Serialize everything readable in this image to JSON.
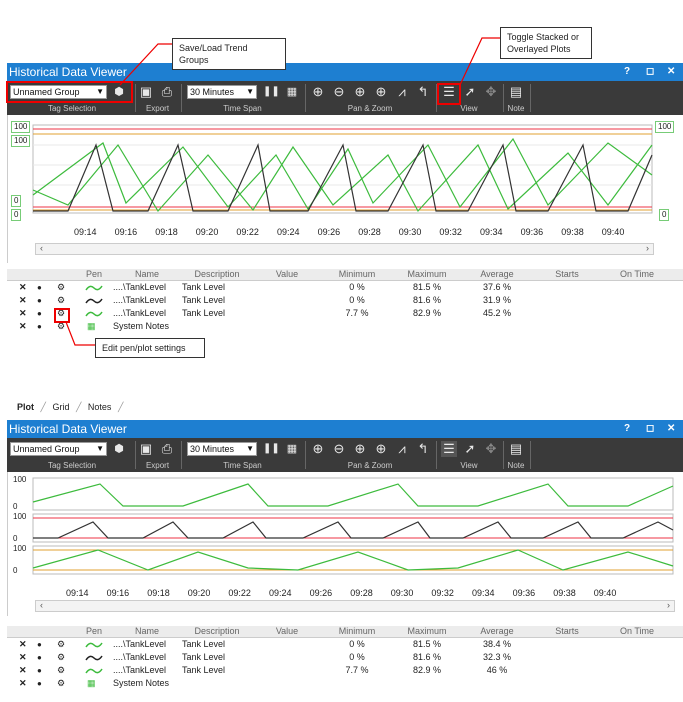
{
  "callouts": {
    "save_load": "Save/Load Trend Groups",
    "toggle": "Toggle Stacked or Overlayed Plots",
    "edit_pen": "Edit pen/plot settings"
  },
  "window_title": "Historical Data Viewer",
  "title_controls": {
    "help": "?",
    "max": "◻",
    "close": "✕"
  },
  "toolbar": {
    "group_select": "Unnamed Group",
    "tag_selection": "Tag Selection",
    "export": "Export",
    "timespan_select": "30 Minutes",
    "time_span": "Time Span",
    "pan_zoom": "Pan & Zoom",
    "view": "View",
    "note": "Note"
  },
  "top_plot": {
    "y_labels": {
      "top_left": "100",
      "top_left2": "100",
      "bottom_left": "0",
      "bottom_left2": "0",
      "top_right": "100",
      "bottom_right": "0"
    },
    "x_ticks": [
      "09:14",
      "09:16",
      "09:18",
      "09:20",
      "09:22",
      "09:24",
      "09:26",
      "09:28",
      "09:30",
      "09:32",
      "09:34",
      "09:36",
      "09:38",
      "09:40"
    ]
  },
  "bottom_plot": {
    "y_labels": {
      "s1_top": "100",
      "s1_bottom": "0",
      "s2_top": "100",
      "s2_bottom": "0",
      "s3_top": "100",
      "s3_bottom": "0"
    },
    "x_ticks": [
      "09:14",
      "09:16",
      "09:18",
      "09:20",
      "09:22",
      "09:24",
      "09:26",
      "09:28",
      "09:30",
      "09:32",
      "09:34",
      "09:36",
      "09:38",
      "09:40"
    ]
  },
  "pen_headers": {
    "pen": "Pen",
    "name": "Name",
    "description": "Description",
    "value": "Value",
    "minimum": "Minimum",
    "maximum": "Maximum",
    "average": "Average",
    "starts": "Starts",
    "on_time": "On Time"
  },
  "pens_top": [
    {
      "name": "....\\TankLevel",
      "description": "Tank Level",
      "minimum": "0 %",
      "maximum": "81.5 %",
      "average": "37.6 %",
      "color": "#3dbb3d"
    },
    {
      "name": "....\\TankLevel",
      "description": "Tank Level",
      "minimum": "0 %",
      "maximum": "81.6 %",
      "average": "31.9 %",
      "color": "#222222"
    },
    {
      "name": "....\\TankLevel",
      "description": "Tank Level",
      "minimum": "7.7 %",
      "maximum": "82.9 %",
      "average": "45.2 %",
      "color": "#3dbb3d"
    }
  ],
  "pens_bottom": [
    {
      "name": "....\\TankLevel",
      "description": "Tank Level",
      "minimum": "0 %",
      "maximum": "81.5 %",
      "average": "38.4 %",
      "color": "#3dbb3d"
    },
    {
      "name": "....\\TankLevel",
      "description": "Tank Level",
      "minimum": "0 %",
      "maximum": "81.6 %",
      "average": "32.3 %",
      "color": "#222222"
    },
    {
      "name": "....\\TankLevel",
      "description": "Tank Level",
      "minimum": "7.7 %",
      "maximum": "82.9 %",
      "average": "46 %",
      "color": "#3dbb3d"
    }
  ],
  "system_notes": "System Notes",
  "tabs": {
    "plot": "Plot",
    "grid": "Grid",
    "notes": "Notes"
  },
  "icons": {
    "delete": "✕",
    "eye": "👁",
    "gear": "⚙",
    "note": "▦"
  }
}
